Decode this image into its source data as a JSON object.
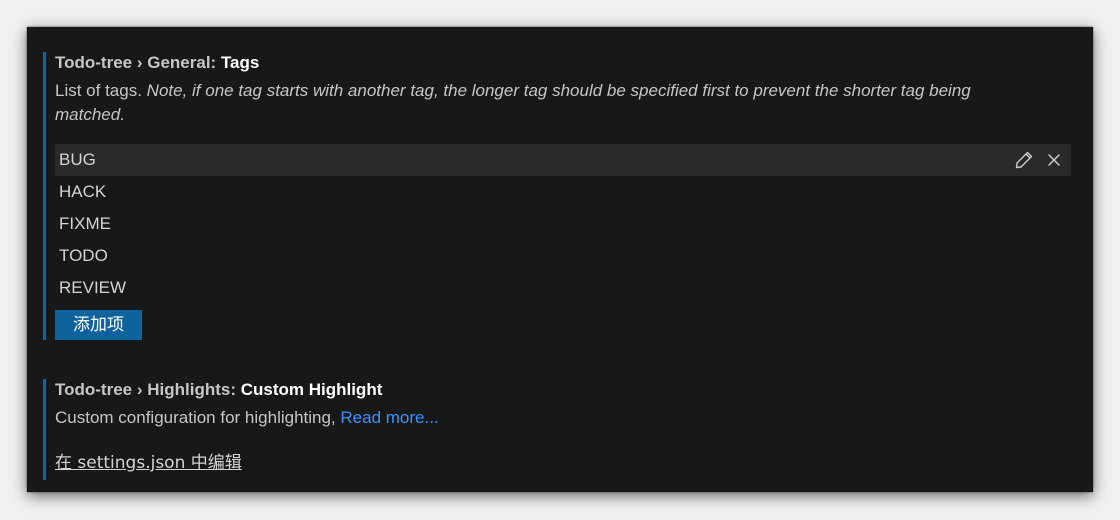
{
  "tags_setting": {
    "prefix": "Todo-tree › General: ",
    "key": "Tags",
    "description_plain": "List of tags. ",
    "description_italic": "Note, if one tag starts with another tag, the longer tag should be specified first to prevent the shorter tag being matched.",
    "items": [
      {
        "label": "BUG"
      },
      {
        "label": "HACK"
      },
      {
        "label": "FIXME"
      },
      {
        "label": "TODO"
      },
      {
        "label": "REVIEW"
      }
    ],
    "add_button_label": "添加项",
    "edit_icon": "pencil-icon",
    "remove_icon": "close-icon"
  },
  "highlights_setting": {
    "prefix": "Todo-tree › Highlights: ",
    "key": "Custom Highlight",
    "description": "Custom configuration for highlighting, ",
    "link_label": "Read more...",
    "edit_in_json_label": "在 settings.json 中编辑"
  },
  "colors": {
    "background": "#181818",
    "accent_border": "#0a67a8",
    "button": "#0e639c",
    "link": "#3794ff",
    "selected_row": "#2a2a2d"
  }
}
